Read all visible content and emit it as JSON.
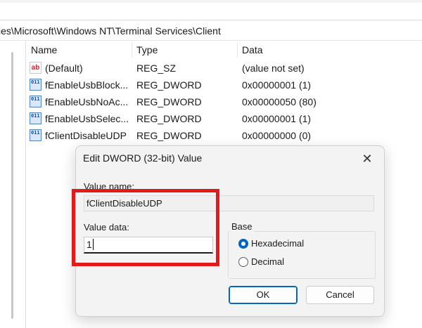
{
  "address": {
    "path": "ies\\Microsoft\\Windows NT\\Terminal Services\\Client"
  },
  "list": {
    "columns": [
      "Name",
      "Type",
      "Data"
    ],
    "rows": [
      {
        "icon": "string-value-icon",
        "icon_text": "ab",
        "name": "(Default)",
        "type": "REG_SZ",
        "data": "(value not set)"
      },
      {
        "icon": "binary-value-icon",
        "icon_text": "011",
        "name": "fEnableUsbBlock...",
        "type": "REG_DWORD",
        "data": "0x00000001 (1)"
      },
      {
        "icon": "binary-value-icon",
        "icon_text": "011",
        "name": "fEnableUsbNoAc...",
        "type": "REG_DWORD",
        "data": "0x00000050 (80)"
      },
      {
        "icon": "binary-value-icon",
        "icon_text": "011",
        "name": "fEnableUsbSelec...",
        "type": "REG_DWORD",
        "data": "0x00000001 (1)"
      },
      {
        "icon": "binary-value-icon",
        "icon_text": "011",
        "name": "fClientDisableUDP",
        "type": "REG_DWORD",
        "data": "0x00000000 (0)"
      }
    ]
  },
  "dialog": {
    "title": "Edit DWORD (32-bit) Value",
    "close_glyph": "✕",
    "value_name_label": "Value name:",
    "value_name": "fClientDisableUDP",
    "value_data_label": "Value data:",
    "value_data": "1",
    "base_label": "Base",
    "radio_hex": "Hexadecimal",
    "radio_dec": "Decimal",
    "selected_base": "Hexadecimal",
    "ok_label": "OK",
    "cancel_label": "Cancel"
  },
  "colors": {
    "accent": "#0067c0",
    "highlight": "#e01b1b"
  }
}
